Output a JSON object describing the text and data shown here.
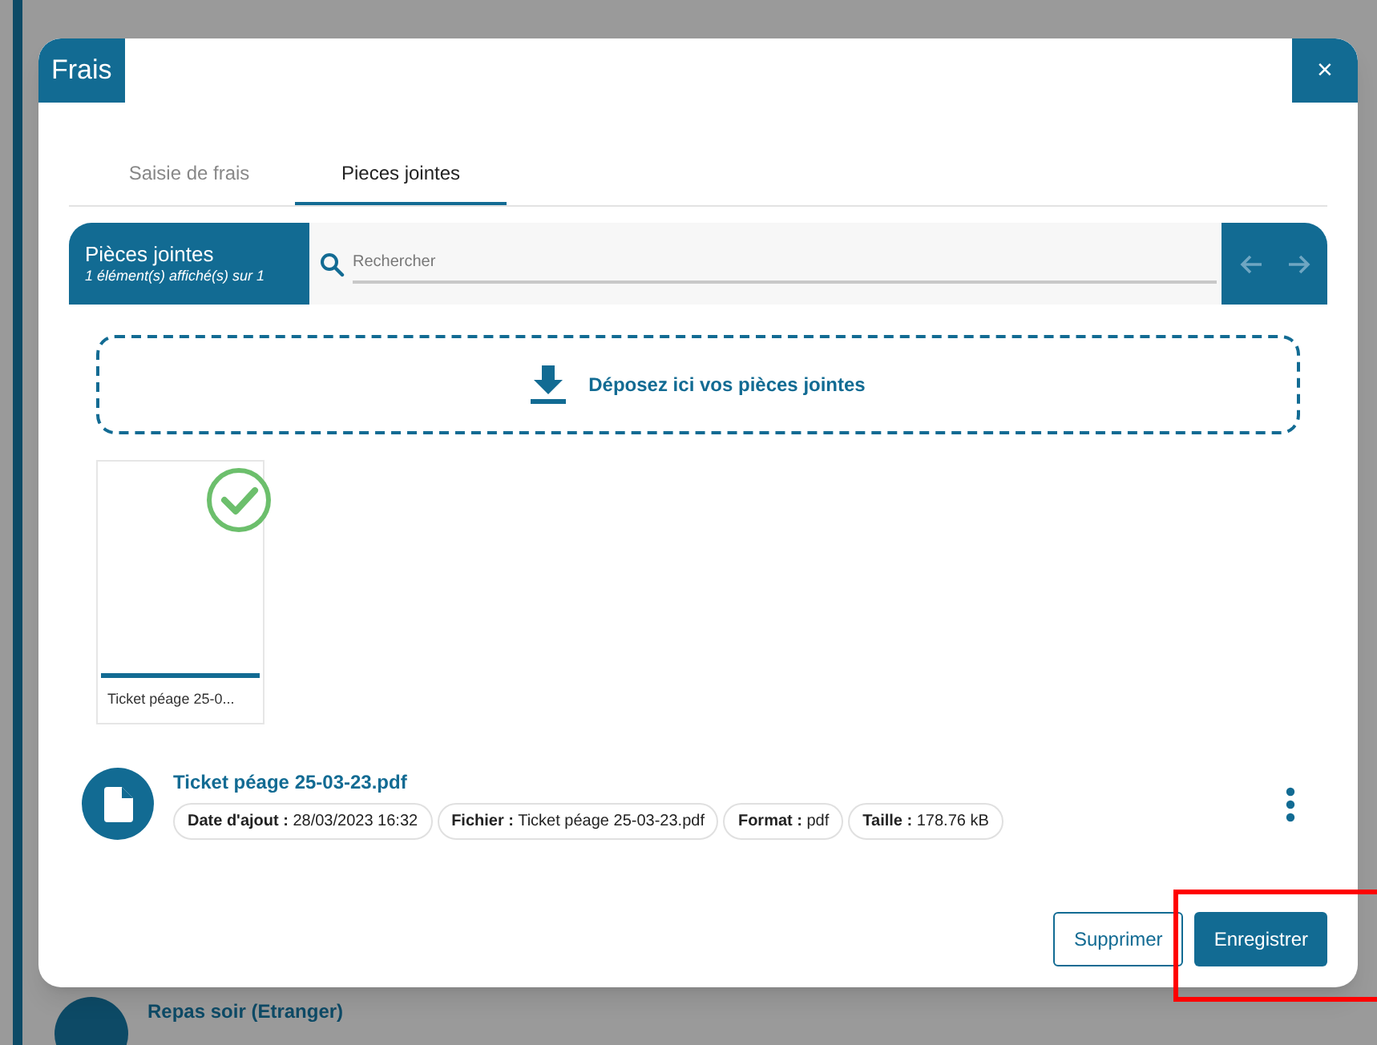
{
  "background": {
    "item_title": "Repas soir (Etranger)"
  },
  "dialog": {
    "title": "Frais",
    "close": "×",
    "tabs": [
      {
        "label": "Saisie de frais",
        "selected": false
      },
      {
        "label": "Pieces jointes",
        "selected": true
      }
    ],
    "panel": {
      "title": "Pièces jointes",
      "subtitle": "1 élément(s) affiché(s) sur 1",
      "search": {
        "placeholder": "Rechercher"
      }
    },
    "dropzone": "Déposez ici vos pièces jointes",
    "thumbnails": [
      {
        "caption": "Ticket péage 25-0...",
        "checked": true
      }
    ],
    "files": [
      {
        "name": "Ticket péage 25-03-23.pdf",
        "details": [
          {
            "label": "Date d'ajout :",
            "value": "28/03/2023 16:32"
          },
          {
            "label": "Fichier :",
            "value": "Ticket péage 25-03-23.pdf"
          },
          {
            "label": "Format :",
            "value": "pdf"
          },
          {
            "label": "Taille :",
            "value": "178.76 kB"
          }
        ]
      }
    ],
    "buttons": [
      {
        "label": "Supprimer",
        "kind": "outline"
      },
      {
        "label": "Enregistrer",
        "kind": "primary",
        "highlighted": true
      }
    ]
  }
}
